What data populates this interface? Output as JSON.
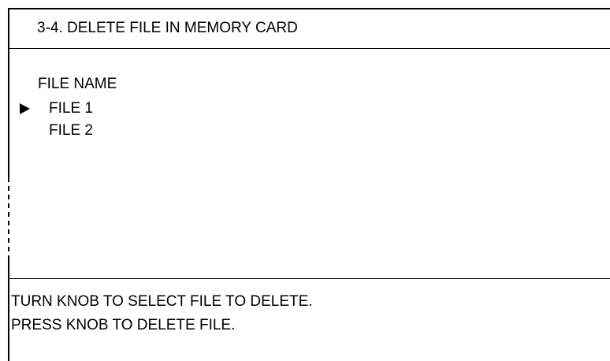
{
  "screen": {
    "title": "3-4. DELETE FILE IN MEMORY CARD"
  },
  "file_list": {
    "header": "FILE NAME",
    "cursor_icon": "right-triangle-cursor",
    "selected_index": 0,
    "items": [
      {
        "label": "FILE 1"
      },
      {
        "label": "FILE 2"
      }
    ]
  },
  "instructions": {
    "line1": "TURN KNOB TO SELECT FILE TO DELETE.",
    "line2": "PRESS KNOB TO DELETE FILE."
  }
}
